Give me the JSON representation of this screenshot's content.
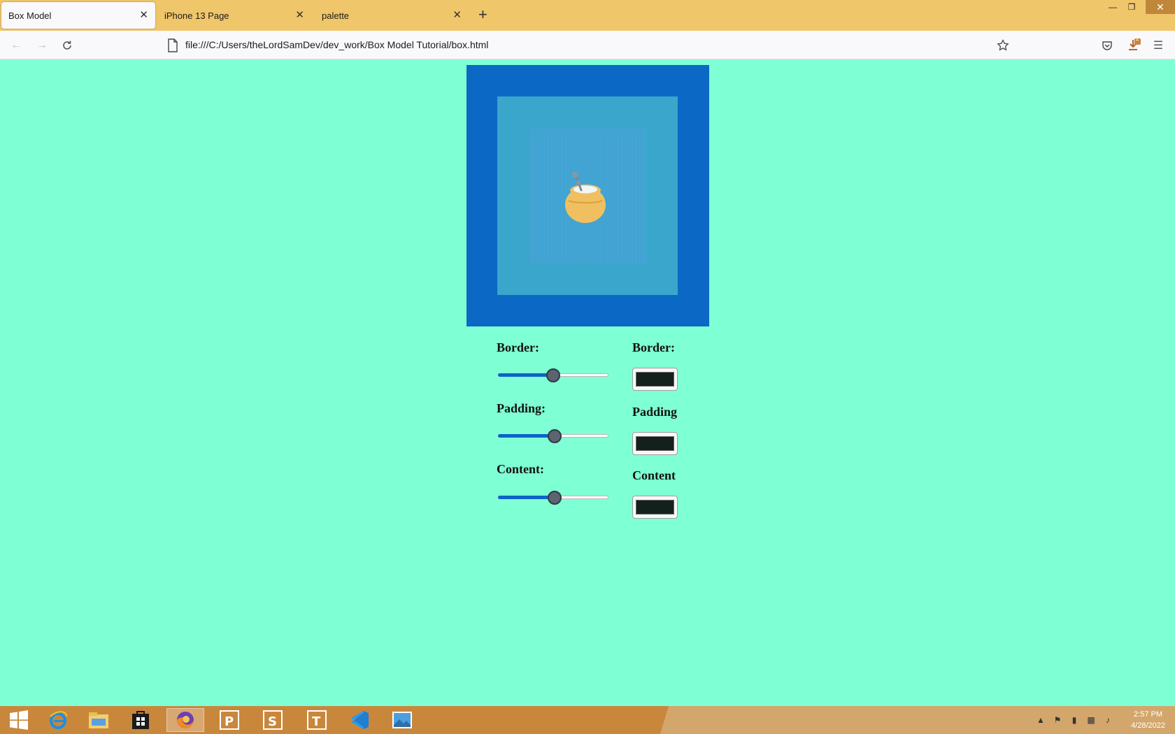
{
  "browser": {
    "tabs": [
      {
        "title": "Box Model",
        "active": true
      },
      {
        "title": "iPhone 13 Page",
        "active": false
      },
      {
        "title": "palette",
        "active": false
      }
    ],
    "url": "file:///C:/Users/theLordSamDev/dev_work/Box Model Tutorial/box.html",
    "downloads_badge": "2"
  },
  "page": {
    "colors": {
      "background": "#7fffd4",
      "border_box": "#0c68c5",
      "padding_box": "#3aa6cc",
      "content_box": "#3a9fd0",
      "swatch_value": "#14201c"
    },
    "content_image": "honey-pot-icon",
    "sliders": [
      {
        "label": "Border:",
        "value": 0.5
      },
      {
        "label": "Padding:",
        "value": 0.51
      },
      {
        "label": "Content:",
        "value": 0.51
      }
    ],
    "color_pickers": [
      {
        "label": "Border:"
      },
      {
        "label": "Padding"
      },
      {
        "label": "Content"
      }
    ]
  },
  "taskbar": {
    "apps": [
      "windows-start",
      "internet-explorer",
      "file-explorer",
      "store",
      "firefox",
      "project",
      "sway",
      "teams-t",
      "vscode",
      "photos"
    ],
    "clock_time": "2:57 PM",
    "clock_date": "4/28/2022"
  }
}
